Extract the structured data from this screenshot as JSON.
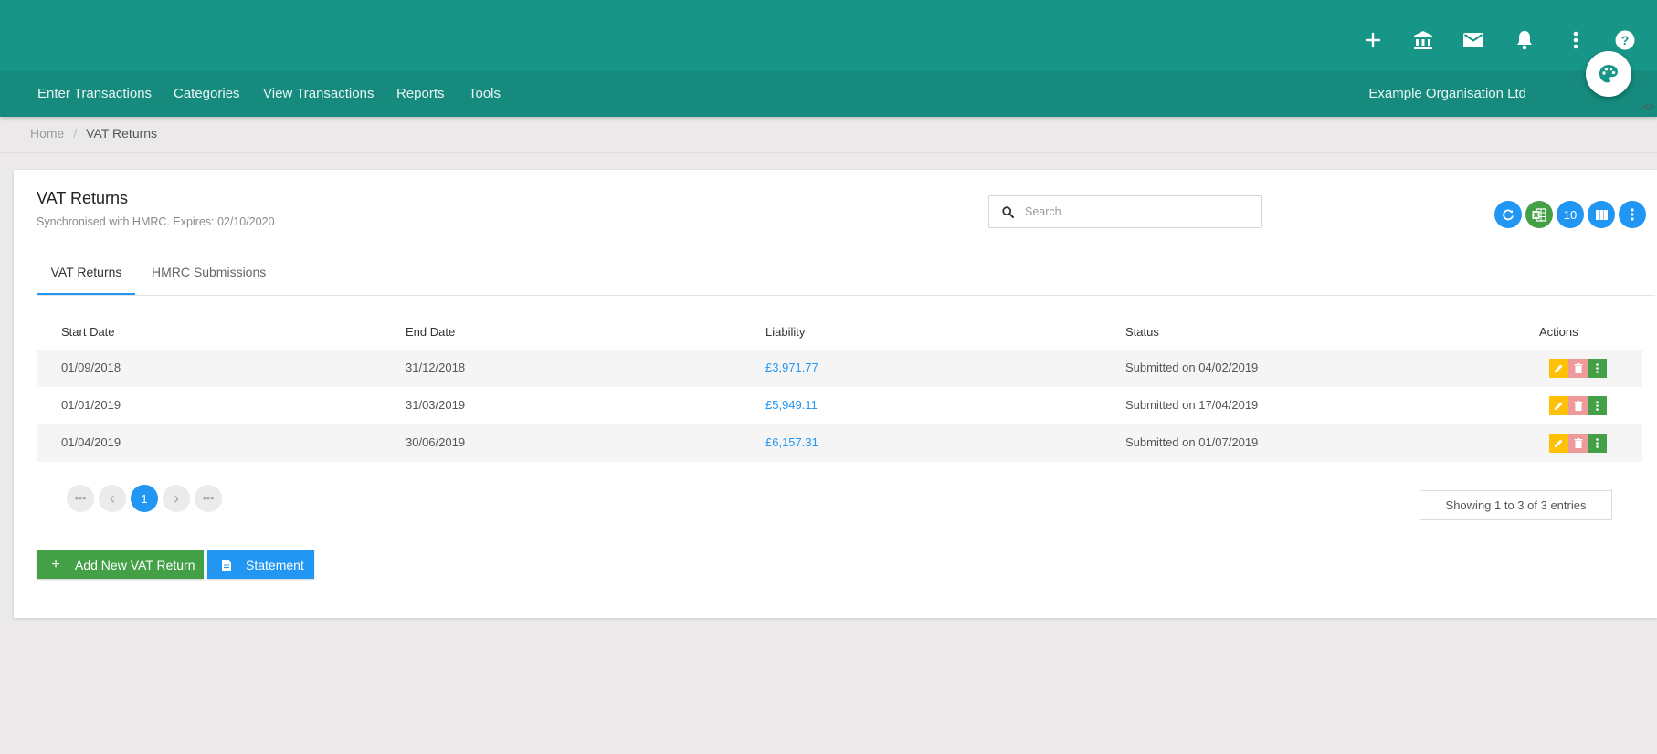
{
  "nav": {
    "items": [
      "Enter Transactions",
      "Categories",
      "View Transactions",
      "Reports",
      "Tools"
    ],
    "organisation": "Example Organisation Ltd",
    "icons": [
      "plus-icon",
      "bank-icon",
      "mail-icon",
      "bell-icon",
      "more-vert-icon",
      "help-icon",
      "palette-icon"
    ],
    "code_toggle": "<>"
  },
  "breadcrumb": {
    "home": "Home",
    "separator": "/",
    "current": "VAT Returns"
  },
  "card": {
    "title": "VAT Returns",
    "subtitle": "Synchronised with HMRC. Expires: 02/10/2020",
    "search_placeholder": "Search",
    "page_size": "10"
  },
  "tabs": [
    "VAT Returns",
    "HMRC Submissions"
  ],
  "table": {
    "headers": [
      "Start Date",
      "End Date",
      "Liability",
      "Status",
      "Actions"
    ],
    "rows": [
      {
        "start": "01/09/2018",
        "end": "31/12/2018",
        "liability": "£3,971.77",
        "status": "Submitted on 04/02/2019"
      },
      {
        "start": "01/01/2019",
        "end": "31/03/2019",
        "liability": "£5,949.11",
        "status": "Submitted on 17/04/2019"
      },
      {
        "start": "01/04/2019",
        "end": "30/06/2019",
        "liability": "£6,157.31",
        "status": "Submitted on 01/07/2019"
      }
    ]
  },
  "pagination": {
    "current_page": "1",
    "first": "•••",
    "prev": "‹",
    "next": "›",
    "last": "•••"
  },
  "entries_text": "Showing 1 to 3 of 3 entries",
  "buttons": {
    "add": "Add New VAT Return",
    "add_icon": "+",
    "statement": "Statement"
  },
  "colors": {
    "header": "#179688",
    "nav": "#158a7d",
    "primary": "#2196f3",
    "success": "#43a047",
    "warning": "#ffc107",
    "danger": "#ef9a9a"
  }
}
